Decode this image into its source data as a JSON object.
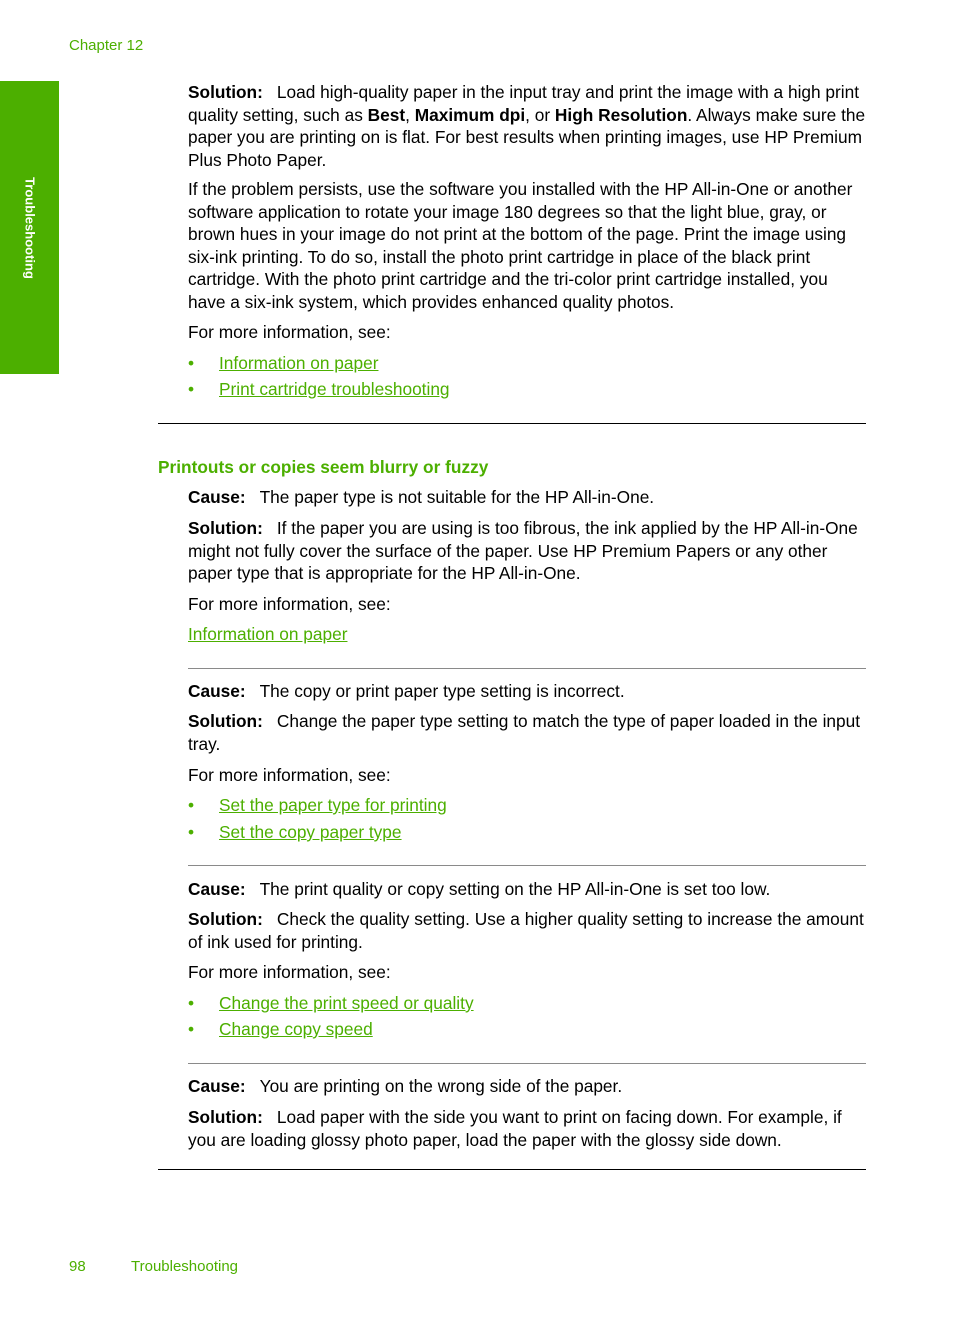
{
  "header": {
    "chapter": "Chapter 12"
  },
  "side_tab": {
    "label": "Troubleshooting"
  },
  "top_section": {
    "solution_label": "Solution:",
    "solution_parts": {
      "t1": "Load high-quality paper in the input tray and print the image with a high print quality setting, such as ",
      "b1": "Best",
      "t2": ", ",
      "b2": "Maximum dpi",
      "t3": ", or ",
      "b3": "High Resolution",
      "t4": ". Always make sure the paper you are printing on is flat. For best results when printing images, use HP Premium Plus Photo Paper."
    },
    "paragraph2": "If the problem persists, use the software you installed with the HP All-in-One or another software application to rotate your image 180 degrees so that the light blue, gray, or brown hues in your image do not print at the bottom of the page. Print the image using six-ink printing. To do so, install the photo print cartridge in place of the black print cartridge. With the photo print cartridge and the tri-color print cartridge installed, you have a six-ink system, which provides enhanced quality photos.",
    "more_info": "For more information, see:",
    "links": [
      "Information on paper",
      "Print cartridge troubleshooting"
    ]
  },
  "section": {
    "heading": "Printouts or copies seem blurry or fuzzy",
    "cause_label": "Cause:",
    "solution_label": "Solution:",
    "more_info": "For more information, see:",
    "bullet": "•",
    "items": [
      {
        "cause": "The paper type is not suitable for the HP All-in-One.",
        "solution": "If the paper you are using is too fibrous, the ink applied by the HP All-in-One might not fully cover the surface of the paper. Use HP Premium Papers or any other paper type that is appropriate for the HP All-in-One.",
        "links": [
          "Information on paper"
        ]
      },
      {
        "cause": "The copy or print paper type setting is incorrect.",
        "solution": "Change the paper type setting to match the type of paper loaded in the input tray.",
        "links": [
          "Set the paper type for printing",
          "Set the copy paper type"
        ]
      },
      {
        "cause": "The print quality or copy setting on the HP All-in-One is set too low.",
        "solution": "Check the quality setting. Use a higher quality setting to increase the amount of ink used for printing.",
        "links": [
          "Change the print speed or quality",
          "Change copy speed"
        ]
      },
      {
        "cause": "You are printing on the wrong side of the paper.",
        "solution": "Load paper with the side you want to print on facing down. For example, if you are loading glossy photo paper, load the paper with the glossy side down."
      }
    ]
  },
  "footer": {
    "page_number": "98",
    "section_title": "Troubleshooting"
  },
  "colors": {
    "accent": "#4caf00",
    "text": "#000000",
    "divider": "#8a8a8a"
  }
}
